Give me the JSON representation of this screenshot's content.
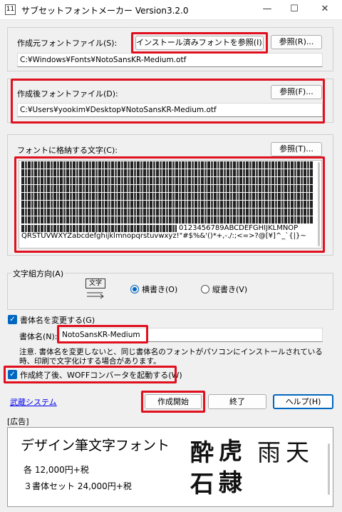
{
  "window": {
    "title": "サブセットフォントメーカー Version3.2.0",
    "app_icon_text": "11",
    "minimize": "—",
    "maximize": "☐",
    "close": "✕"
  },
  "source_font": {
    "label": "作成元フォントファイル(S):",
    "browse_installed_label": "インストール済みフォントを参照(I)...",
    "browse_label": "参照(R)...",
    "path": "C:¥Windows¥Fonts¥NotoSansKR-Medium.otf"
  },
  "output_font": {
    "label": "作成後フォントファイル(D):",
    "browse_label": "参照(F)...",
    "path": "C:¥Users¥yookim¥Desktop¥NotoSansKR-Medium.otf"
  },
  "chars": {
    "label": "フォントに格納する文字(C):",
    "browse_label": "参照(T)...",
    "ascii_line1": "0123456789ABCDEFGHIJKLMNOP",
    "ascii_line2": "QRSTUVWXYZabcdefghijklmnopqrstuvwxyz!\"#$%&'()*+,-./:;<=>?@[¥]^_`{|}~"
  },
  "direction": {
    "label": "文字組方向(A)",
    "icon_text": "文字",
    "horizontal_label": "横書き(O)",
    "vertical_label": "縦書き(V)",
    "selected": "horizontal"
  },
  "rename": {
    "checkbox_label": "書体名を変更する(G)",
    "name_label": "書体名(N):",
    "name_value": "NotoSansKR-Medium",
    "note": "注意. 書体名を変更しないと、同じ書体名のフォントがパソコンにインストールされている時、印刷で文字化けする場合があります。"
  },
  "woff": {
    "checkbox_label": "作成終了後、WOFFコンバータを起動する(W)"
  },
  "footer": {
    "link": "武蔵システム",
    "start_label": "作成開始",
    "close_label": "終了",
    "help_label": "ヘルプ(H)"
  },
  "ad": {
    "label": "[広告]",
    "title": "デザイン筆文字フォント",
    "price_each": "各 12,000円+税",
    "price_set": "３書体セット 24,000円+税",
    "sample_chars": [
      "酔",
      "虎",
      "雨",
      "天",
      "石",
      "隷"
    ]
  },
  "colors": {
    "highlight": "#e0101e",
    "accent": "#0067c0"
  }
}
